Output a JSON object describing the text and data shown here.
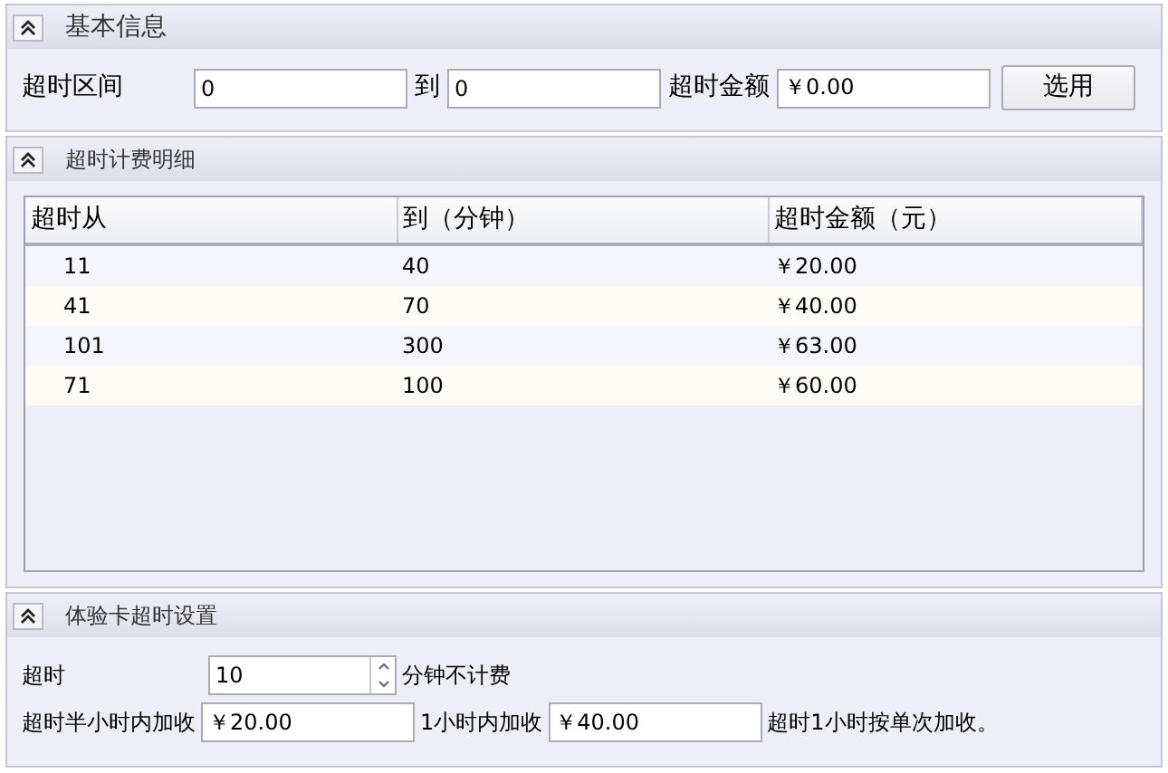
{
  "panels": [
    {
      "kind": "form",
      "title": "基本信息",
      "expanded": true,
      "row": {
        "label": "超时区间",
        "from": "0",
        "to_label": "到",
        "to": "0",
        "amount_label": "超时金额",
        "amount": "￥0.00",
        "button": "选用"
      }
    },
    {
      "kind": "table",
      "title": "超时计费明细",
      "expanded": true,
      "columns": [
        "超时从",
        "到（分钟）",
        "超时金额（元）"
      ],
      "rows": [
        [
          "11",
          "40",
          "￥20.00"
        ],
        [
          "41",
          "70",
          "￥40.00"
        ],
        [
          "101",
          "300",
          "￥63.00"
        ],
        [
          "71",
          "100",
          "￥60.00"
        ]
      ]
    },
    {
      "kind": "settings",
      "title": "体验卡超时设置",
      "expanded": true,
      "timeout_label": "超时",
      "timeout": "10",
      "timeout_suffix": "分钟不计费",
      "half_label": "超时半小时内加收",
      "half": "￥20.00",
      "hour_label": "1小时内加收",
      "hour": "￥40.00",
      "note": "超时1小时按单次加收。"
    }
  ]
}
